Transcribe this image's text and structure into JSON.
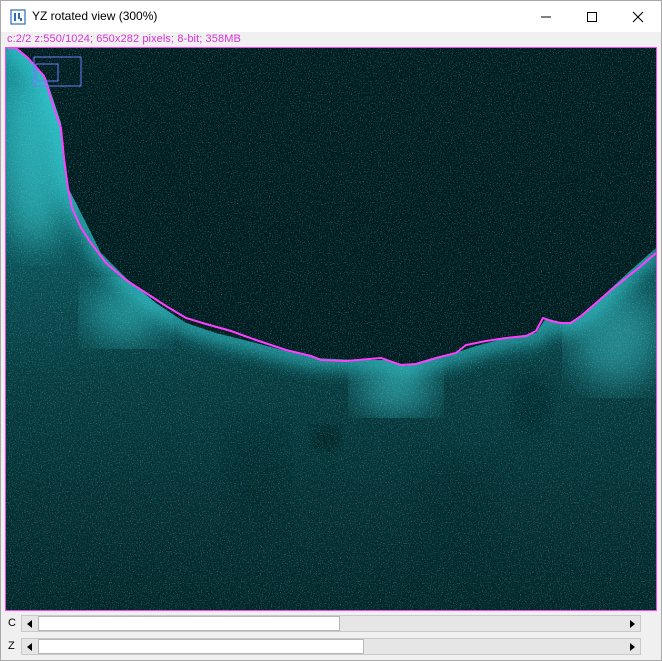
{
  "window": {
    "title": "YZ rotated view (300%)",
    "icon": "imagej-app-icon",
    "controls": [
      "minimize-icon",
      "maximize-icon",
      "close-icon"
    ]
  },
  "image_info": "c:2/2 z:550/1024; 650x282 pixels; 8-bit; 358MB",
  "image": {
    "description_colors": {
      "background": "#011b1e",
      "signal": "#26c8cf",
      "roi_outline": "#ff40ff",
      "navigator": "#6e7cff"
    }
  },
  "sliders": {
    "c": {
      "label": "C",
      "value": 2,
      "max": 2
    },
    "z": {
      "label": "Z",
      "value": 550,
      "max": 1024
    }
  }
}
